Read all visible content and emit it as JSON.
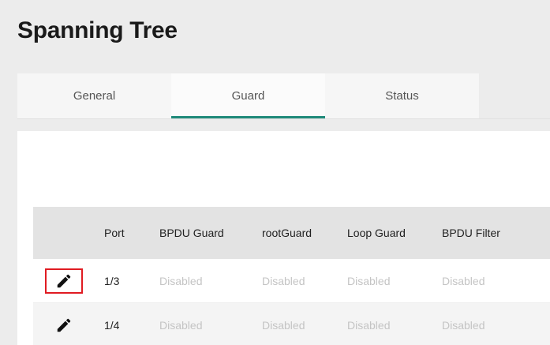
{
  "page": {
    "title": "Spanning Tree"
  },
  "tabs": [
    {
      "label": "General",
      "active": false
    },
    {
      "label": "Guard",
      "active": true
    },
    {
      "label": "Status",
      "active": false
    }
  ],
  "colors": {
    "accent": "#1f8a7a",
    "highlight_border": "#e01b22",
    "disabled_text": "#c4c4c4"
  },
  "table": {
    "columns": [
      "Port",
      "BPDU Guard",
      "rootGuard",
      "Loop Guard",
      "BPDU Filter"
    ],
    "rows": [
      {
        "edit_icon": "pencil-icon",
        "port": "1/3",
        "bpdu_guard": "Disabled",
        "root_guard": "Disabled",
        "loop_guard": "Disabled",
        "bpdu_filter": "Disabled",
        "highlighted": true
      },
      {
        "edit_icon": "pencil-icon",
        "port": "1/4",
        "bpdu_guard": "Disabled",
        "root_guard": "Disabled",
        "loop_guard": "Disabled",
        "bpdu_filter": "Disabled",
        "highlighted": false
      }
    ]
  }
}
